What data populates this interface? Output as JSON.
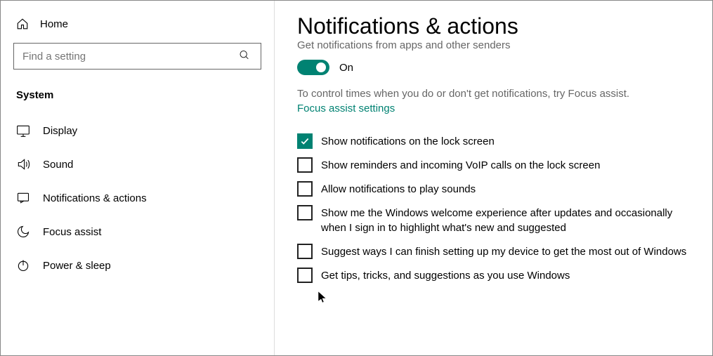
{
  "sidebar": {
    "home": "Home",
    "search_placeholder": "Find a setting",
    "section": "System",
    "items": [
      {
        "label": "Display"
      },
      {
        "label": "Sound"
      },
      {
        "label": "Notifications & actions"
      },
      {
        "label": "Focus assist"
      },
      {
        "label": "Power & sleep"
      }
    ]
  },
  "main": {
    "title": "Notifications & actions",
    "subheading": "Get notifications from apps and other senders",
    "toggle": {
      "label": "On",
      "on": true
    },
    "hint": "To control times when you do or don't get notifications, try Focus assist.",
    "link": "Focus assist settings",
    "checks": [
      {
        "checked": true,
        "label": "Show notifications on the lock screen"
      },
      {
        "checked": false,
        "label": "Show reminders and incoming VoIP calls on the lock screen"
      },
      {
        "checked": false,
        "label": "Allow notifications to play sounds"
      },
      {
        "checked": false,
        "label": "Show me the Windows welcome experience after updates and occasionally when I sign in to highlight what's new and suggested"
      },
      {
        "checked": false,
        "label": "Suggest ways I can finish setting up my device to get the most out of Windows"
      },
      {
        "checked": false,
        "label": "Get tips, tricks, and suggestions as you use Windows"
      }
    ]
  }
}
